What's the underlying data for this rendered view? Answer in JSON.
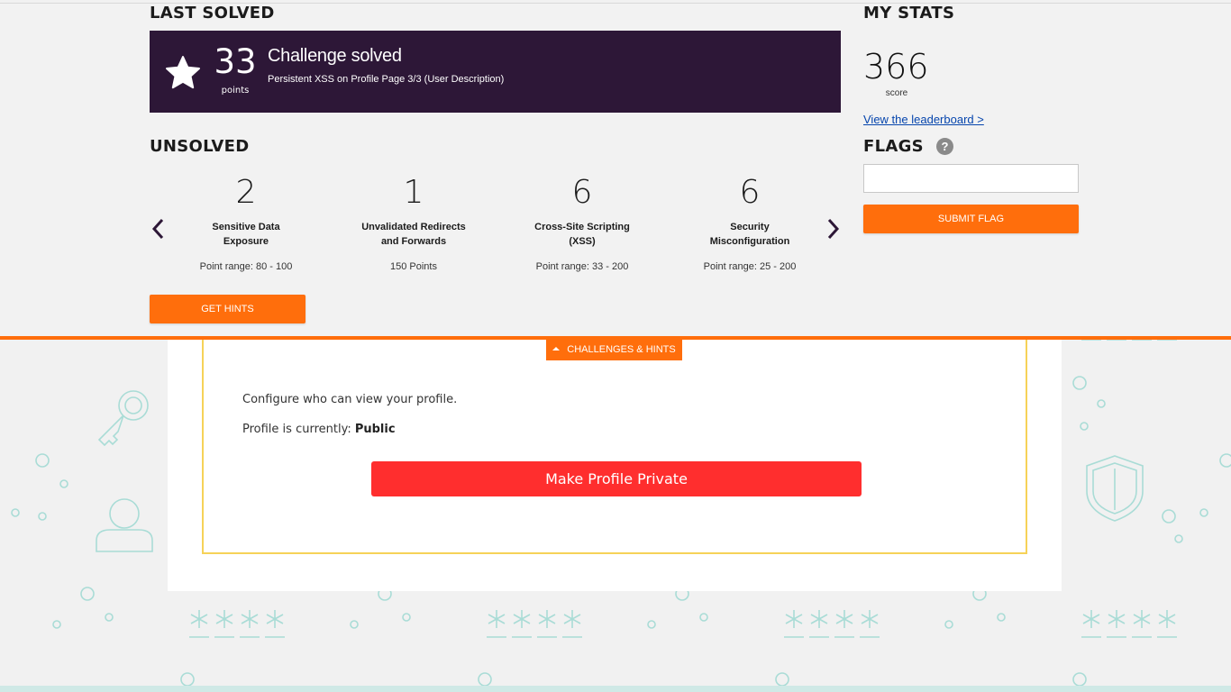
{
  "last_solved": {
    "heading": "LAST SOLVED",
    "points": "33",
    "points_label": "points",
    "title": "Challenge solved",
    "description": "Persistent XSS on Profile Page 3/3 (User Description)"
  },
  "unsolved": {
    "heading": "UNSOLVED",
    "challenges": [
      {
        "count": "2",
        "name": "Sensitive Data Exposure",
        "range": "Point range: 80 - 100"
      },
      {
        "count": "1",
        "name": "Unvalidated Redirects and Forwards",
        "range": "150 Points"
      },
      {
        "count": "6",
        "name": "Cross-Site Scripting (XSS)",
        "range": "Point range: 33 - 200"
      },
      {
        "count": "6",
        "name": "Security Misconfiguration",
        "range": "Point range: 25 - 200"
      }
    ],
    "hints_button": "GET HINTS"
  },
  "stats": {
    "heading": "MY STATS",
    "score": "366",
    "score_label": "score",
    "leaderboard_link": "View the leaderboard >"
  },
  "flags": {
    "heading": "FLAGS",
    "help_icon": "question-circle-icon",
    "input_value": "",
    "submit_label": "SUBMIT FLAG"
  },
  "challenges_tab": {
    "label": "CHALLENGES & HINTS",
    "icon": "caret-up-icon"
  },
  "profile": {
    "config_text": "Configure who can view your profile.",
    "status_prefix": "Profile is currently: ",
    "status_value": "Public",
    "button_label": "Make Profile Private"
  },
  "colors": {
    "accent_orange": "#ff6e0c",
    "banner_purple": "#2d1737",
    "danger_red": "#ff2e2e",
    "card_border_yellow": "#f6d258",
    "decor_teal": "#a9dcd6"
  }
}
